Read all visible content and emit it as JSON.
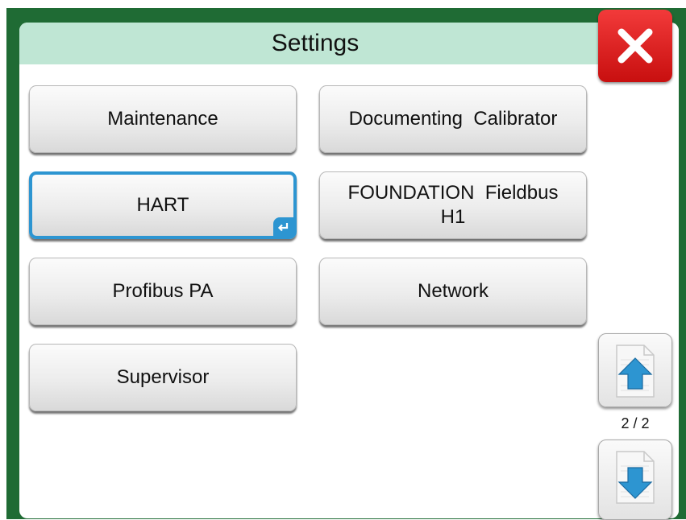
{
  "header": {
    "title": "Settings"
  },
  "buttons": {
    "maintenance": "Maintenance",
    "documenting_calibrator": "Documenting  Calibrator",
    "hart": "HART",
    "foundation_line1": "FOUNDATION  Fieldbus",
    "foundation_line2": "H1",
    "profibus": "Profibus PA",
    "network": "Network",
    "supervisor": "Supervisor"
  },
  "pagination": {
    "indicator": "2 / 2"
  },
  "icons": {
    "close": "close-x-icon",
    "enter": "enter-return-icon",
    "scroll_up": "page-up-arrow-icon",
    "scroll_down": "page-down-arrow-icon"
  },
  "colors": {
    "frame": "#1f6b34",
    "title_bar": "#bfe6d4",
    "close": "#e01c1c",
    "selection": "#2d95d1"
  }
}
